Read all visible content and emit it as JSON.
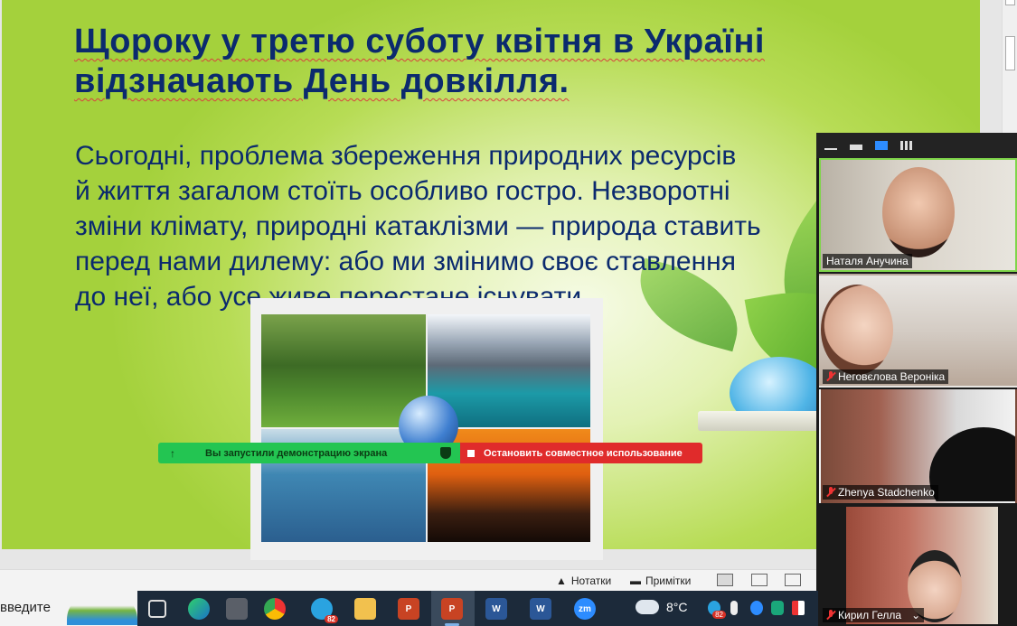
{
  "slide": {
    "title_line1": "Щороку у третю суботу квітня в Україні",
    "title_line2": "відзначають День довкілля.",
    "body_lines": [
      "Сьогодні, проблема збереження природних ресурсів",
      "й життя загалом стоїть особливо гостро. Незворотні",
      "зміни клімату, природні катаклізми — природа ставить",
      "перед нами дилему: або ми змінимо своє ставлення",
      "до неї, або усе живе перестане існувати."
    ]
  },
  "share_bar": {
    "status": "Вы запустили демонстрацию экрана",
    "stop": "Остановить совместное использование",
    "arrow_icon": "↑"
  },
  "statusbar": {
    "notes": "Нотатки",
    "comments": "Примітки"
  },
  "participants": [
    {
      "name": "Наталя Анучина",
      "muted": false
    },
    {
      "name": "Неговєлова Вероніка",
      "muted": true
    },
    {
      "name": "Zhenya Stadchenko",
      "muted": true
    },
    {
      "name": "Кирил Гелла",
      "muted": true
    }
  ],
  "taskbar": {
    "search_text": "введите",
    "telegram_badge": "82",
    "zoom_label": "zm",
    "temperature": "8°C",
    "tray_badge": "82"
  },
  "colors": {
    "slide_text": "#0b2a6e",
    "share_green": "#23c552",
    "share_red": "#e02b2b",
    "active_speaker": "#7fd54a"
  }
}
